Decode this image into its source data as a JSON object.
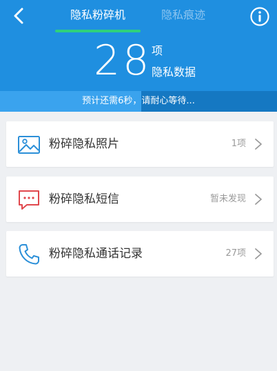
{
  "header": {
    "tabs": [
      {
        "label": "隐私粉碎机",
        "active": true
      },
      {
        "label": "隐私痕迹",
        "active": false
      }
    ],
    "back_icon": "back-arrow-icon",
    "info_icon": "info-circle-icon",
    "count": "28",
    "count_unit": "项",
    "count_label": "隐私数据",
    "progress_text": "预计还需6秒，请耐心等待...",
    "progress_fraction": 0.51
  },
  "items": [
    {
      "title": "粉碎隐私照片",
      "status": "1项",
      "icon": "picture-icon",
      "color": "#2b8fd8"
    },
    {
      "title": "粉碎隐私短信",
      "status": "暂未发现",
      "icon": "message-icon",
      "color": "#e0474c"
    },
    {
      "title": "粉碎隐私通话记录",
      "status": "27项",
      "icon": "phone-icon",
      "color": "#2b8fd8"
    }
  ],
  "colors": {
    "header_bg": "#1f8fe0",
    "progress_bg": "#1578c2",
    "progress_fill": "#3aa3ee",
    "tab_underline": "#2fd07c",
    "page_bg": "#eef0f3"
  }
}
